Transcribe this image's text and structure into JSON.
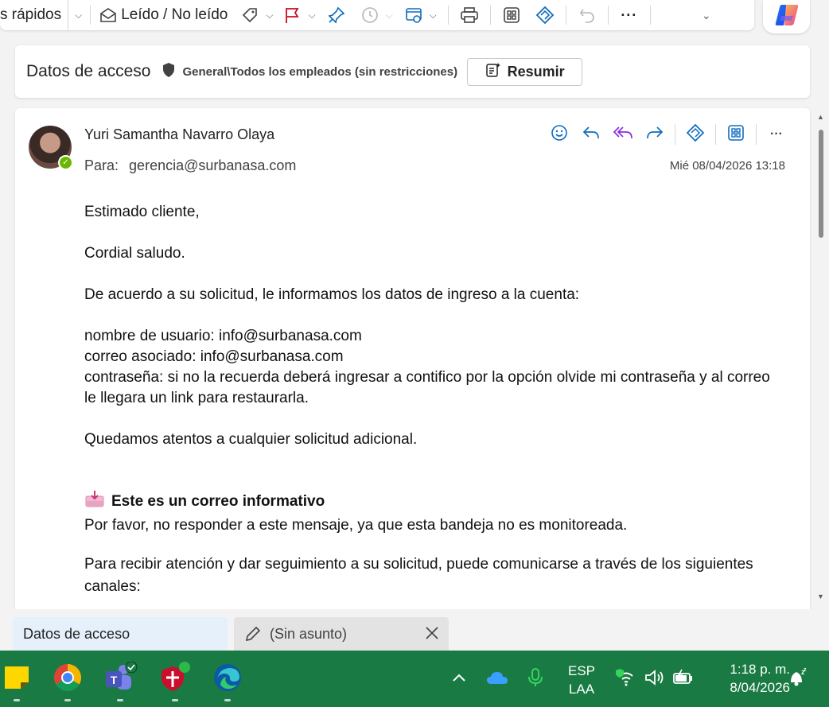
{
  "toolbar": {
    "quick_steps_label": "s rápidos",
    "read_unread_label": "Leído / No leído"
  },
  "subject": {
    "title": "Datos de acceso",
    "sensitivity_label": "General\\Todos los empleados (sin restricciones)",
    "summarize_label": "Resumir"
  },
  "message": {
    "sender": "Yuri Samantha Navarro Olaya",
    "to_label": "Para:",
    "to_address": "gerencia@surbanasa.com",
    "date": "Mié 08/04/2026 13:18",
    "body": {
      "greeting": "Estimado cliente,",
      "salute": "Cordial saludo.",
      "intro": "De acuerdo a su solicitud, le informamos los datos de ingreso a la cuenta:",
      "username_line": "nombre de usuario: info@surbanasa.com",
      "email_line": "correo asociado: info@surbanasa.com",
      "password_line": "contraseña: si no la recuerda deberá ingresar a contifico por la opción olvide mi contraseña y al correo le llegara un link para restaurarla.",
      "closing": "Quedamos atentos a cualquier solicitud adicional.",
      "info_title": "Este es un correo informativo",
      "info_text": "Por favor, no responder a este mensaje, ya que esta bandeja no es monitoreada.",
      "channels_text": "Para recibir atención y dar seguimiento a su solicitud, puede comunicarse a través de los siguientes canales:"
    }
  },
  "tabs": [
    {
      "label": "Datos de acceso"
    },
    {
      "label": "(Sin asunto)"
    }
  ],
  "taskbar": {
    "language_top": "ESP",
    "language_bottom": "LAA",
    "time": "1:18 p. m.",
    "date": "8/04/2026"
  },
  "colors": {
    "accent": "#0f6cbd",
    "taskbar": "#1a7a43",
    "presence": "#6bb700",
    "flag": "#c50f1f",
    "reply_all": "#8a2be2"
  }
}
